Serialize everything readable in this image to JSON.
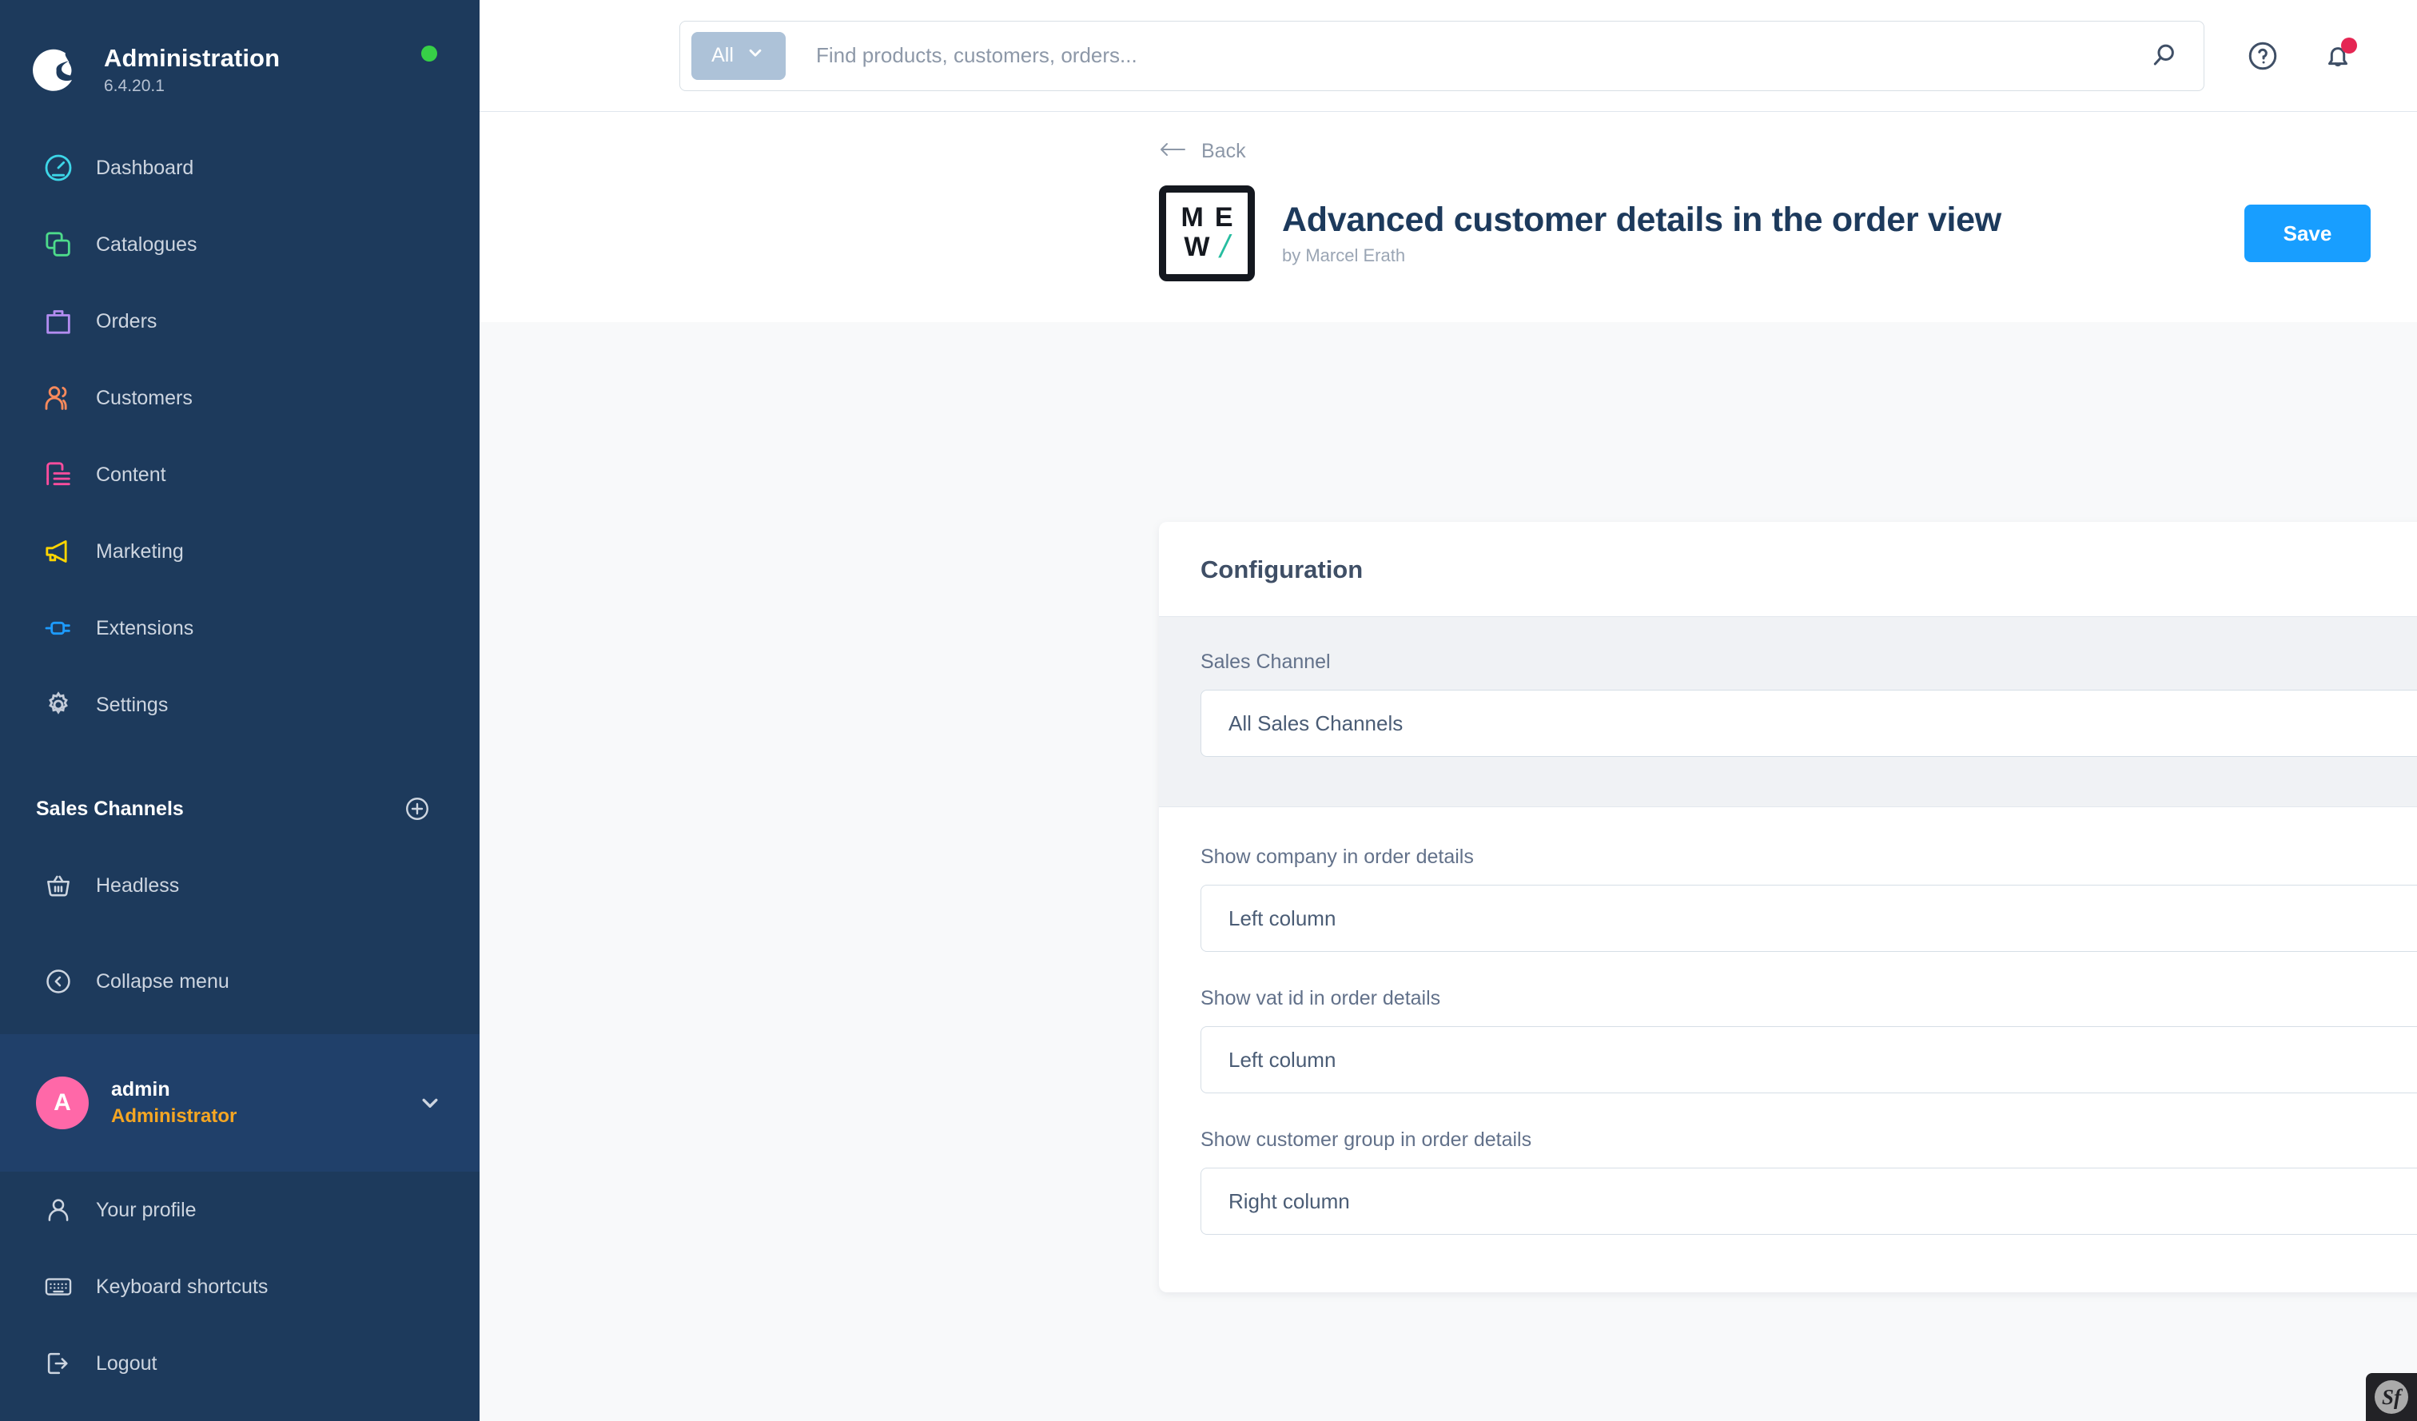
{
  "sidebar": {
    "brand": {
      "title": "Administration",
      "version": "6.4.20.1",
      "status": "online",
      "status_color": "#37d047"
    },
    "nav": [
      {
        "label": "Dashboard",
        "icon": "gauge-icon",
        "color": "#3dd6e8"
      },
      {
        "label": "Catalogues",
        "icon": "layers-icon",
        "color": "#4ddb8b"
      },
      {
        "label": "Orders",
        "icon": "bag-icon",
        "color": "#b28cf0"
      },
      {
        "label": "Customers",
        "icon": "users-icon",
        "color": "#fa8a5c"
      },
      {
        "label": "Content",
        "icon": "content-icon",
        "color": "#ff4d9e"
      },
      {
        "label": "Marketing",
        "icon": "megaphone-icon",
        "color": "#ffd500"
      },
      {
        "label": "Extensions",
        "icon": "plug-icon",
        "color": "#1d9bff"
      },
      {
        "label": "Settings",
        "icon": "gear-icon",
        "color": "#c3cbd8"
      }
    ],
    "sales_channels": {
      "title": "Sales Channels",
      "add_icon": "plus-circle-icon",
      "items": [
        {
          "label": "Headless",
          "icon": "basket-icon"
        }
      ]
    },
    "collapse": {
      "label": "Collapse menu",
      "icon": "chevron-left-circle-icon"
    },
    "user": {
      "initial": "A",
      "name": "admin",
      "role": "Administrator",
      "chevron": "chevron-down-icon",
      "avatar_color": "#ff68a8"
    },
    "bottom": [
      {
        "label": "Your profile",
        "icon": "person-icon"
      },
      {
        "label": "Keyboard shortcuts",
        "icon": "keyboard-icon"
      },
      {
        "label": "Logout",
        "icon": "logout-icon"
      }
    ]
  },
  "topbar": {
    "search": {
      "scope_label": "All",
      "scope_chevron": "chevron-down-icon",
      "placeholder": "Find products, customers, orders...",
      "value": "",
      "search_icon": "search-icon"
    },
    "help_icon": "help-circle-icon",
    "notifications_icon": "bell-icon",
    "notification_badge_color": "#e52653"
  },
  "pagehead": {
    "back_label": "Back",
    "back_icon": "arrow-left-icon",
    "logo": {
      "line1": [
        "M",
        "E"
      ],
      "line2_char": "W",
      "line2_slash": "/",
      "slash_color": "#27bda0"
    },
    "title": "Advanced customer details in the order view",
    "author": "by Marcel Erath",
    "save_label": "Save",
    "save_color": "#189eff"
  },
  "card": {
    "title": "Configuration",
    "sales_channel": {
      "label": "Sales Channel",
      "value": "All Sales Channels",
      "chevron": "chevron-down-icon"
    },
    "fields": [
      {
        "label": "Show company in order details",
        "value": "Left column",
        "chevron": "chevron-down-icon"
      },
      {
        "label": "Show vat id in order details",
        "value": "Left column",
        "chevron": "chevron-down-icon"
      },
      {
        "label": "Show customer group in order details",
        "value": "Right column",
        "chevron": "chevron-down-icon"
      }
    ]
  },
  "debug_toolbar": {
    "label": "Sf",
    "icon": "symfony-icon"
  }
}
